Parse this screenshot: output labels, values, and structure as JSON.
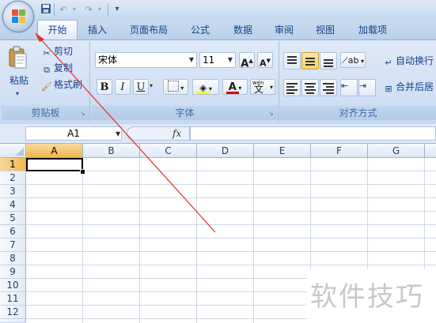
{
  "qat": {
    "save_icon": "save-icon",
    "undo_icon": "undo-icon",
    "redo_icon": "redo-icon",
    "more": "▾"
  },
  "tabs": [
    "开始",
    "插入",
    "页面布局",
    "公式",
    "数据",
    "审阅",
    "视图",
    "加载项"
  ],
  "clipboard": {
    "paste": "粘贴",
    "cut": "剪切",
    "copy": "复制",
    "format_painter": "格式刷",
    "group_label": "剪贴板"
  },
  "font": {
    "family": "宋体",
    "size": "11",
    "grow": "A",
    "shrink": "A",
    "bold": "B",
    "italic": "I",
    "underline": "U",
    "font_color_letter": "A",
    "phonetic": "文",
    "phonetic_small": "wén",
    "group_label": "字体",
    "highlight_color": "#ffff00",
    "font_color": "#e00000"
  },
  "alignment": {
    "wrap_text": "自动换行",
    "merge_center": "合并后居",
    "group_label": "对齐方式"
  },
  "formula_bar": {
    "name_box": "A1",
    "fx": "fx",
    "value": ""
  },
  "grid": {
    "columns": [
      "A",
      "B",
      "C",
      "D",
      "E",
      "F",
      "G"
    ],
    "rows": [
      "1",
      "2",
      "3",
      "4",
      "5",
      "6",
      "7",
      "8",
      "9",
      "10",
      "11",
      "12"
    ],
    "active_cell": "A1"
  },
  "watermark": "软件技巧",
  "colors": {
    "ribbon": "#d3e1f4",
    "accent": "#15428b",
    "annotation_arrow": "#e03030"
  }
}
